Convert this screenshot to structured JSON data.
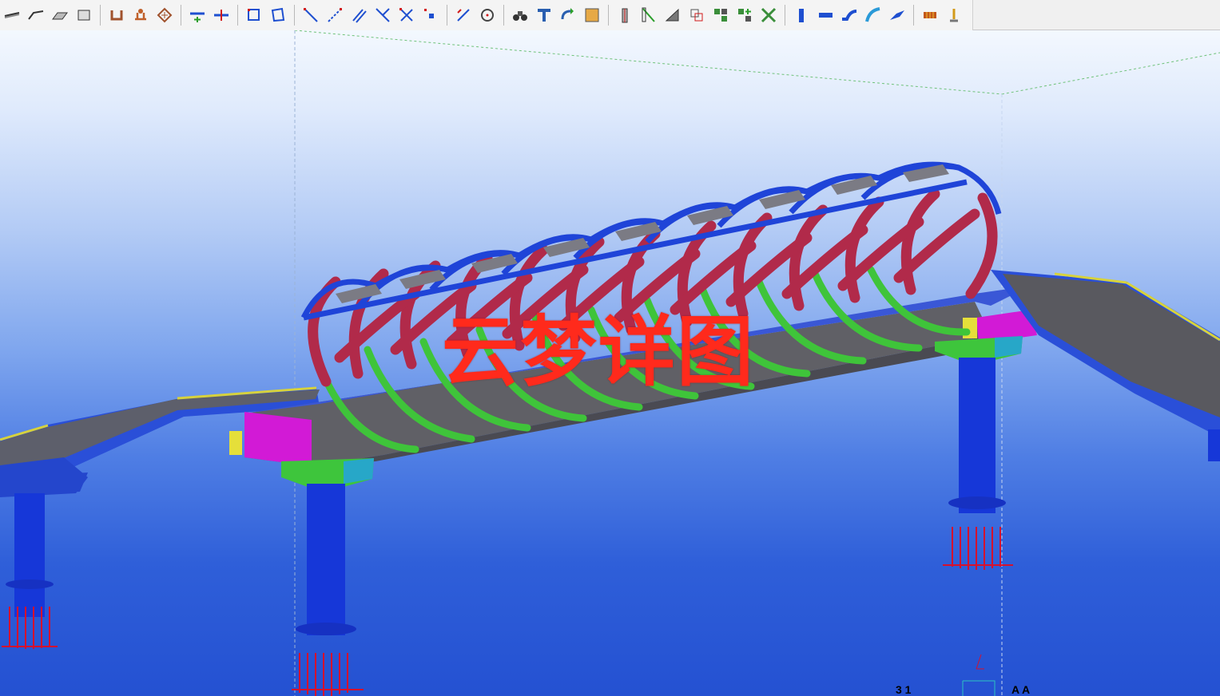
{
  "watermark": {
    "text": "云梦详图"
  },
  "grid_labels": {
    "left": "3 1",
    "right": "A A"
  },
  "colors": {
    "arch_rib_blue": "#1f44d8",
    "diagonal_red": "#b12a4a",
    "bracing_green": "#3fc43a",
    "deck_grey": "#6d6d73",
    "deck_edge_yellow": "#d7d23c",
    "bearing_magenta": "#d21ad6",
    "column_blue": "#1637d8",
    "anchor_red": "#d5112e",
    "cap_green": "#3ec53c",
    "cap_cyan": "#27a7c8"
  },
  "toolbar": {
    "groups": [
      [
        "beam-icon",
        "polybeam-icon",
        "slab-icon",
        "panel-icon"
      ],
      [
        "u-profile-icon",
        "component-icon",
        "hatch-icon"
      ],
      [
        "add-point-icon",
        "split-icon"
      ],
      [
        "rect-select-icon",
        "polygon-select-icon"
      ],
      [
        "line-icon",
        "dashed-line-icon",
        "parallel-icon",
        "angle-icon",
        "cross-icon",
        "point-icon"
      ],
      [
        "offset-icon",
        "circle-icon"
      ],
      [
        "binoculars-icon",
        "profile-t-icon",
        "rotate-view-icon",
        "render-box-icon"
      ],
      [
        "column-icon",
        "brace-icon",
        "plate-icon",
        "copy-icon",
        "assembly-icon",
        "assembly-add-icon",
        "assembly-remove-icon"
      ],
      [
        "vertical-bar-icon",
        "horizontal-bar-icon",
        "bent-plate-icon",
        "curved-beam-icon",
        "sloped-slab-icon"
      ],
      [
        "weld-icon",
        "bolt-icon"
      ]
    ]
  }
}
